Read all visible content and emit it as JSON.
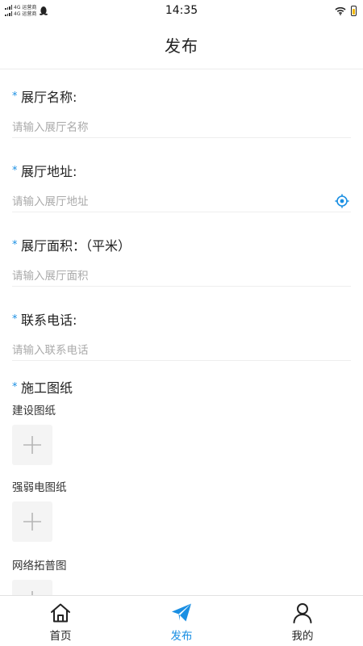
{
  "status_bar": {
    "carrier_line1": "4G 运营商",
    "carrier_line2": "4G 运营商",
    "time": "14:35"
  },
  "header": {
    "title": "发布"
  },
  "form": {
    "hall_name": {
      "label": "展厅名称:",
      "placeholder": "请输入展厅名称",
      "value": ""
    },
    "hall_address": {
      "label": "展厅地址:",
      "placeholder": "请输入展厅地址",
      "value": ""
    },
    "hall_area": {
      "label": "展厅面积：（平米）",
      "placeholder": "请输入展厅面积",
      "value": ""
    },
    "contact_phone": {
      "label": "联系电话:",
      "placeholder": "请输入联系电话",
      "value": ""
    },
    "drawings": {
      "label": "施工图纸",
      "groups": [
        {
          "label": "建设图纸"
        },
        {
          "label": "强弱电图纸"
        },
        {
          "label": "网络拓普图"
        }
      ]
    },
    "required_mark": "*"
  },
  "tab_bar": {
    "active_color": "#1a8fe3",
    "items": [
      {
        "label": "首页",
        "icon": "home-icon"
      },
      {
        "label": "发布",
        "icon": "paper-plane-icon"
      },
      {
        "label": "我的",
        "icon": "user-icon"
      }
    ]
  }
}
